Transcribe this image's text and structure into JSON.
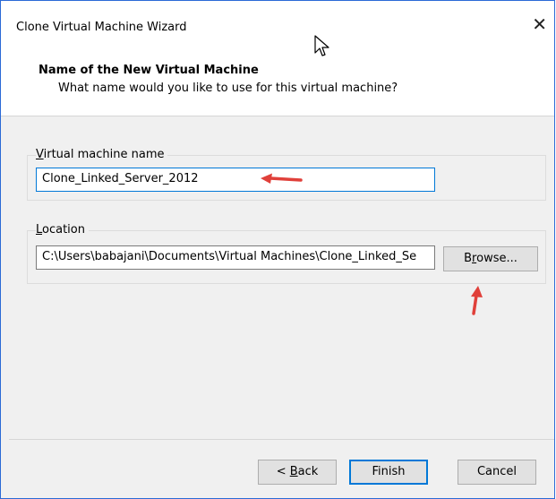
{
  "window": {
    "title": "Clone Virtual Machine Wizard",
    "close_glyph": "✕"
  },
  "header": {
    "title": "Name of the New Virtual Machine",
    "subtitle": "What name would you like to use for this virtual machine?"
  },
  "name_group": {
    "label": "Virtual machine name",
    "label_hotkey": "V",
    "label_rest": "irtual machine name",
    "value": "Clone_Linked_Server_2012"
  },
  "location_group": {
    "label": "Location",
    "label_hotkey": "L",
    "label_rest": "ocation",
    "value": "C:\\Users\\babajani\\Documents\\Virtual Machines\\Clone_Linked_Se",
    "browse_label": "Browse...",
    "browse_hotkey": "r",
    "browse_pre": "B",
    "browse_post": "owse..."
  },
  "footer": {
    "back_label": "< Back",
    "back_pre": "< ",
    "back_hotkey": "B",
    "back_post": "ack",
    "finish_label": "Finish",
    "cancel_label": "Cancel"
  },
  "icons": {
    "close": "close-icon",
    "cursor": "mouse-pointer-icon",
    "annotation": "red-arrow-icon"
  },
  "colors": {
    "window_border": "#2b6ad6",
    "input_focus_border": "#0078d7",
    "annotation_arrow": "#e0403a"
  }
}
